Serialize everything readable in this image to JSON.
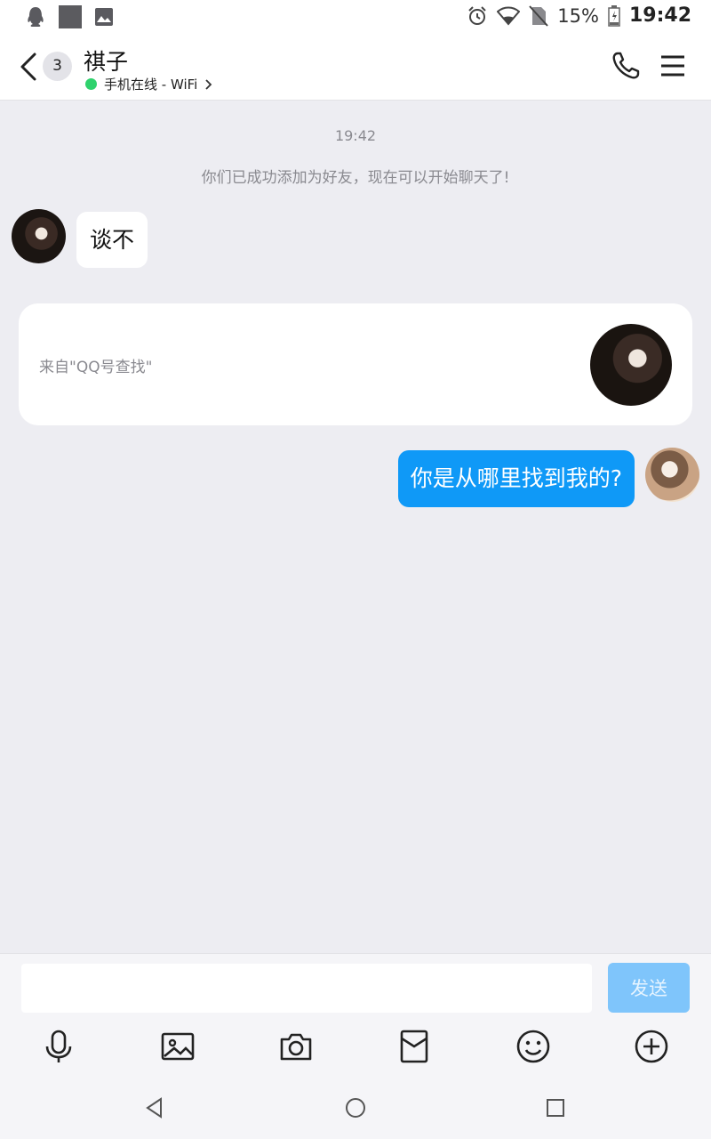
{
  "status_bar": {
    "icons": [
      "qq-notification-icon",
      "app-notification-icon",
      "gallery-icon",
      "alarm-icon",
      "wifi-icon",
      "no-sim-icon",
      "battery-icon"
    ],
    "battery": "15%",
    "time": "19:42"
  },
  "header": {
    "unread_count": "3",
    "contact_name": "祺子",
    "status_text": "手机在线 - WiFi",
    "online_color": "#2fd26d"
  },
  "chat": {
    "timestamp": "19:42",
    "system_message": "你们已成功添加为好友，现在可以开始聊天了!",
    "incoming_message": "谈不",
    "card_text": "来自\"QQ号查找\"",
    "outgoing_message": "你是从哪里找到我的?",
    "outgoing_bubble_color": "#0f99f7"
  },
  "input": {
    "value": "",
    "placeholder": "",
    "send_label": "发送",
    "send_color": "#7fc5fb"
  },
  "toolbar": {
    "icons": [
      "microphone-icon",
      "image-icon",
      "camera-icon",
      "red-packet-icon",
      "emoji-icon",
      "plus-icon"
    ]
  },
  "navbar": {
    "icons": [
      "back-triangle-icon",
      "home-circle-icon",
      "recents-square-icon"
    ]
  }
}
